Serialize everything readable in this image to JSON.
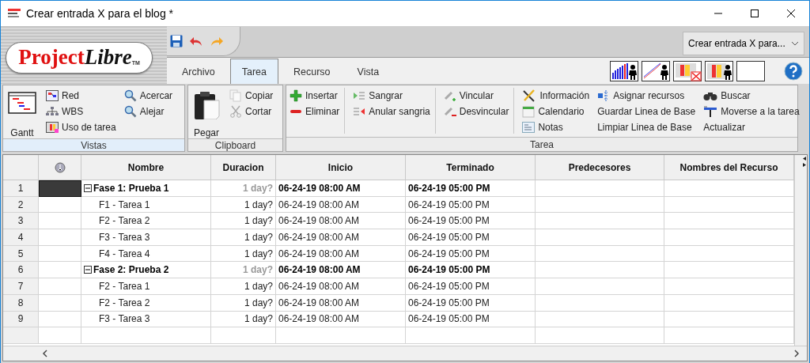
{
  "window": {
    "title": "Crear entrada X para el blog *"
  },
  "logo": {
    "first": "Project",
    "second": "Libre",
    "trademark": "TM"
  },
  "project_selector": {
    "value": "Crear entrada X para..."
  },
  "tabs": [
    {
      "label": "Archivo",
      "selected": false
    },
    {
      "label": "Tarea",
      "selected": true
    },
    {
      "label": "Recurso",
      "selected": false
    },
    {
      "label": "Vista",
      "selected": false
    }
  ],
  "ribbon": {
    "groups": [
      {
        "label": "Vistas",
        "highlighted": true,
        "columns": [
          {
            "divider_after": false,
            "items": [
              {
                "label": "Gantt",
                "kind": "large"
              }
            ]
          },
          {
            "divider_after": false,
            "items": [
              {
                "label": "Red",
                "kind": "icon"
              },
              {
                "label": "WBS",
                "kind": "icon"
              },
              {
                "label": "Uso de tarea",
                "kind": "icon"
              }
            ]
          },
          {
            "divider_after": false,
            "items": [
              {
                "label": "Acercar",
                "kind": "icon"
              },
              {
                "label": "Alejar",
                "kind": "icon"
              }
            ]
          }
        ]
      },
      {
        "label": "Clipboard",
        "highlighted": false,
        "columns": [
          {
            "divider_after": false,
            "items": [
              {
                "label": "Pegar",
                "kind": "large"
              }
            ]
          },
          {
            "divider_after": false,
            "items": [
              {
                "label": "Copiar",
                "kind": "icon"
              },
              {
                "label": "Cortar",
                "kind": "icon"
              }
            ]
          }
        ]
      },
      {
        "label": "Tarea",
        "highlighted": false,
        "columns": [
          {
            "divider_after": true,
            "items": [
              {
                "label": "Insertar",
                "kind": "icon"
              },
              {
                "label": "Eliminar",
                "kind": "icon"
              }
            ]
          },
          {
            "divider_after": true,
            "items": [
              {
                "label": "Sangrar",
                "kind": "icon"
              },
              {
                "label": "Anular sangria",
                "kind": "icon"
              }
            ]
          },
          {
            "divider_after": true,
            "items": [
              {
                "label": "Vincular",
                "kind": "icon"
              },
              {
                "label": "Desvincular",
                "kind": "icon"
              }
            ]
          },
          {
            "divider_after": false,
            "items": [
              {
                "label": "Información",
                "kind": "icon"
              },
              {
                "label": "Calendario",
                "kind": "icon"
              },
              {
                "label": "Notas",
                "kind": "icon"
              }
            ]
          },
          {
            "divider_after": false,
            "items": [
              {
                "label": "Asignar recursos",
                "kind": "icon"
              },
              {
                "label": "Guardar Linea de Base",
                "kind": "text"
              },
              {
                "label": "Limpiar Linea de Base",
                "kind": "text"
              }
            ]
          },
          {
            "divider_after": false,
            "items": [
              {
                "label": "Buscar",
                "kind": "icon"
              },
              {
                "label": "Moverse a la tarea",
                "kind": "icon"
              },
              {
                "label": "Actualizar",
                "kind": "text"
              }
            ]
          }
        ]
      }
    ]
  },
  "table": {
    "columns": [
      "Nombre",
      "Duracion",
      "Inicio",
      "Terminado",
      "Predecesores",
      "Nombres del Recurso"
    ],
    "tasks": [
      {
        "number": "1",
        "name": "Fase 1: Prueba 1",
        "duration": "1 day?",
        "start": "06-24-19 08:00 AM",
        "finish": "06-24-19 05:00 PM",
        "selected": true,
        "expanded": true,
        "children": [
          {
            "number": "2",
            "name": "F1 - Tarea 1",
            "duration": "1 day?",
            "start": "06-24-19 08:00 AM",
            "finish": "06-24-19 05:00 PM",
            "selected": false
          },
          {
            "number": "3",
            "name": "F2 - Tarea 2",
            "duration": "1 day?",
            "start": "06-24-19 08:00 AM",
            "finish": "06-24-19 05:00 PM",
            "selected": false
          },
          {
            "number": "4",
            "name": "F3 - Tarea 3",
            "duration": "1 day?",
            "start": "06-24-19 08:00 AM",
            "finish": "06-24-19 05:00 PM",
            "selected": false
          },
          {
            "number": "5",
            "name": "F4 - Tarea 4",
            "duration": "1 day?",
            "start": "06-24-19 08:00 AM",
            "finish": "06-24-19 05:00 PM",
            "selected": false
          }
        ]
      },
      {
        "number": "6",
        "name": "Fase 2: Prueba 2",
        "duration": "1 day?",
        "start": "06-24-19 08:00 AM",
        "finish": "06-24-19 05:00 PM",
        "selected": false,
        "expanded": true,
        "children": [
          {
            "number": "7",
            "name": "F2 - Tarea 1",
            "duration": "1 day?",
            "start": "06-24-19 08:00 AM",
            "finish": "06-24-19 05:00 PM",
            "selected": false
          },
          {
            "number": "8",
            "name": "F2 - Tarea 2",
            "duration": "1 day?",
            "start": "06-24-19 08:00 AM",
            "finish": "06-24-19 05:00 PM",
            "selected": false
          },
          {
            "number": "9",
            "name": "F3 - Tarea 3",
            "duration": "1 day?",
            "start": "06-24-19 08:00 AM",
            "finish": "06-24-19 05:00 PM",
            "selected": false
          }
        ]
      }
    ]
  }
}
